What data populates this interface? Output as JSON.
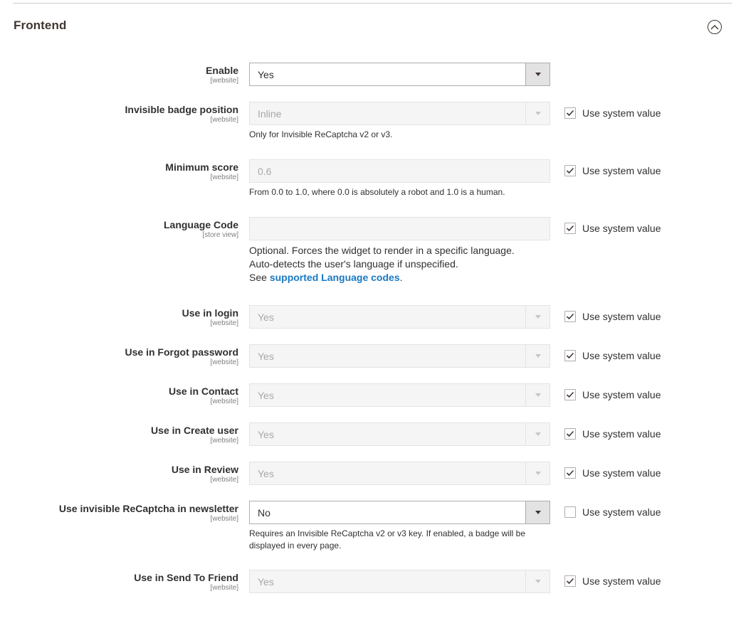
{
  "section": {
    "title": "Frontend",
    "collapse_icon": "chevron-up-circle-icon"
  },
  "system_value_label": "Use system value",
  "fields": {
    "enable": {
      "label": "Enable",
      "scope": "[website]",
      "value": "Yes"
    },
    "badge_position": {
      "label": "Invisible badge position",
      "scope": "[website]",
      "value": "Inline",
      "note": "Only for Invisible ReCaptcha v2 or v3.",
      "use_system": true
    },
    "minimum_score": {
      "label": "Minimum score",
      "scope": "[website]",
      "value": "0.6",
      "note": "From 0.0 to 1.0, where 0.0 is absolutely a robot and 1.0 is a human.",
      "use_system": true
    },
    "language_code": {
      "label": "Language Code",
      "scope": "[store view]",
      "value": "",
      "note_line1": "Optional. Forces the widget to render in a specific language.",
      "note_line2": "Auto-detects the user's language if unspecified.",
      "note_see": "See ",
      "note_link": "supported Language codes",
      "note_end": ".",
      "use_system": true
    },
    "use_in_login": {
      "label": "Use in login",
      "scope": "[website]",
      "value": "Yes",
      "use_system": true
    },
    "use_in_forgot_password": {
      "label": "Use in Forgot password",
      "scope": "[website]",
      "value": "Yes",
      "use_system": true
    },
    "use_in_contact": {
      "label": "Use in Contact",
      "scope": "[website]",
      "value": "Yes",
      "use_system": true
    },
    "use_in_create_user": {
      "label": "Use in Create user",
      "scope": "[website]",
      "value": "Yes",
      "use_system": true
    },
    "use_in_review": {
      "label": "Use in Review",
      "scope": "[website]",
      "value": "Yes",
      "use_system": true
    },
    "use_in_newsletter": {
      "label": "Use invisible ReCaptcha in newsletter",
      "scope": "[website]",
      "value": "No",
      "note_line1": "Requires an Invisible ReCaptcha v2 or v3 key. If enabled, a badge will be",
      "note_line2": "displayed in every page.",
      "use_system": false
    },
    "use_in_send_to_friend": {
      "label": "Use in Send To Friend",
      "scope": "[website]",
      "value": "Yes",
      "use_system": true
    }
  },
  "colors": {
    "link": "#1979c3",
    "title": "#41362f",
    "disabled_bg": "#f5f5f5"
  }
}
